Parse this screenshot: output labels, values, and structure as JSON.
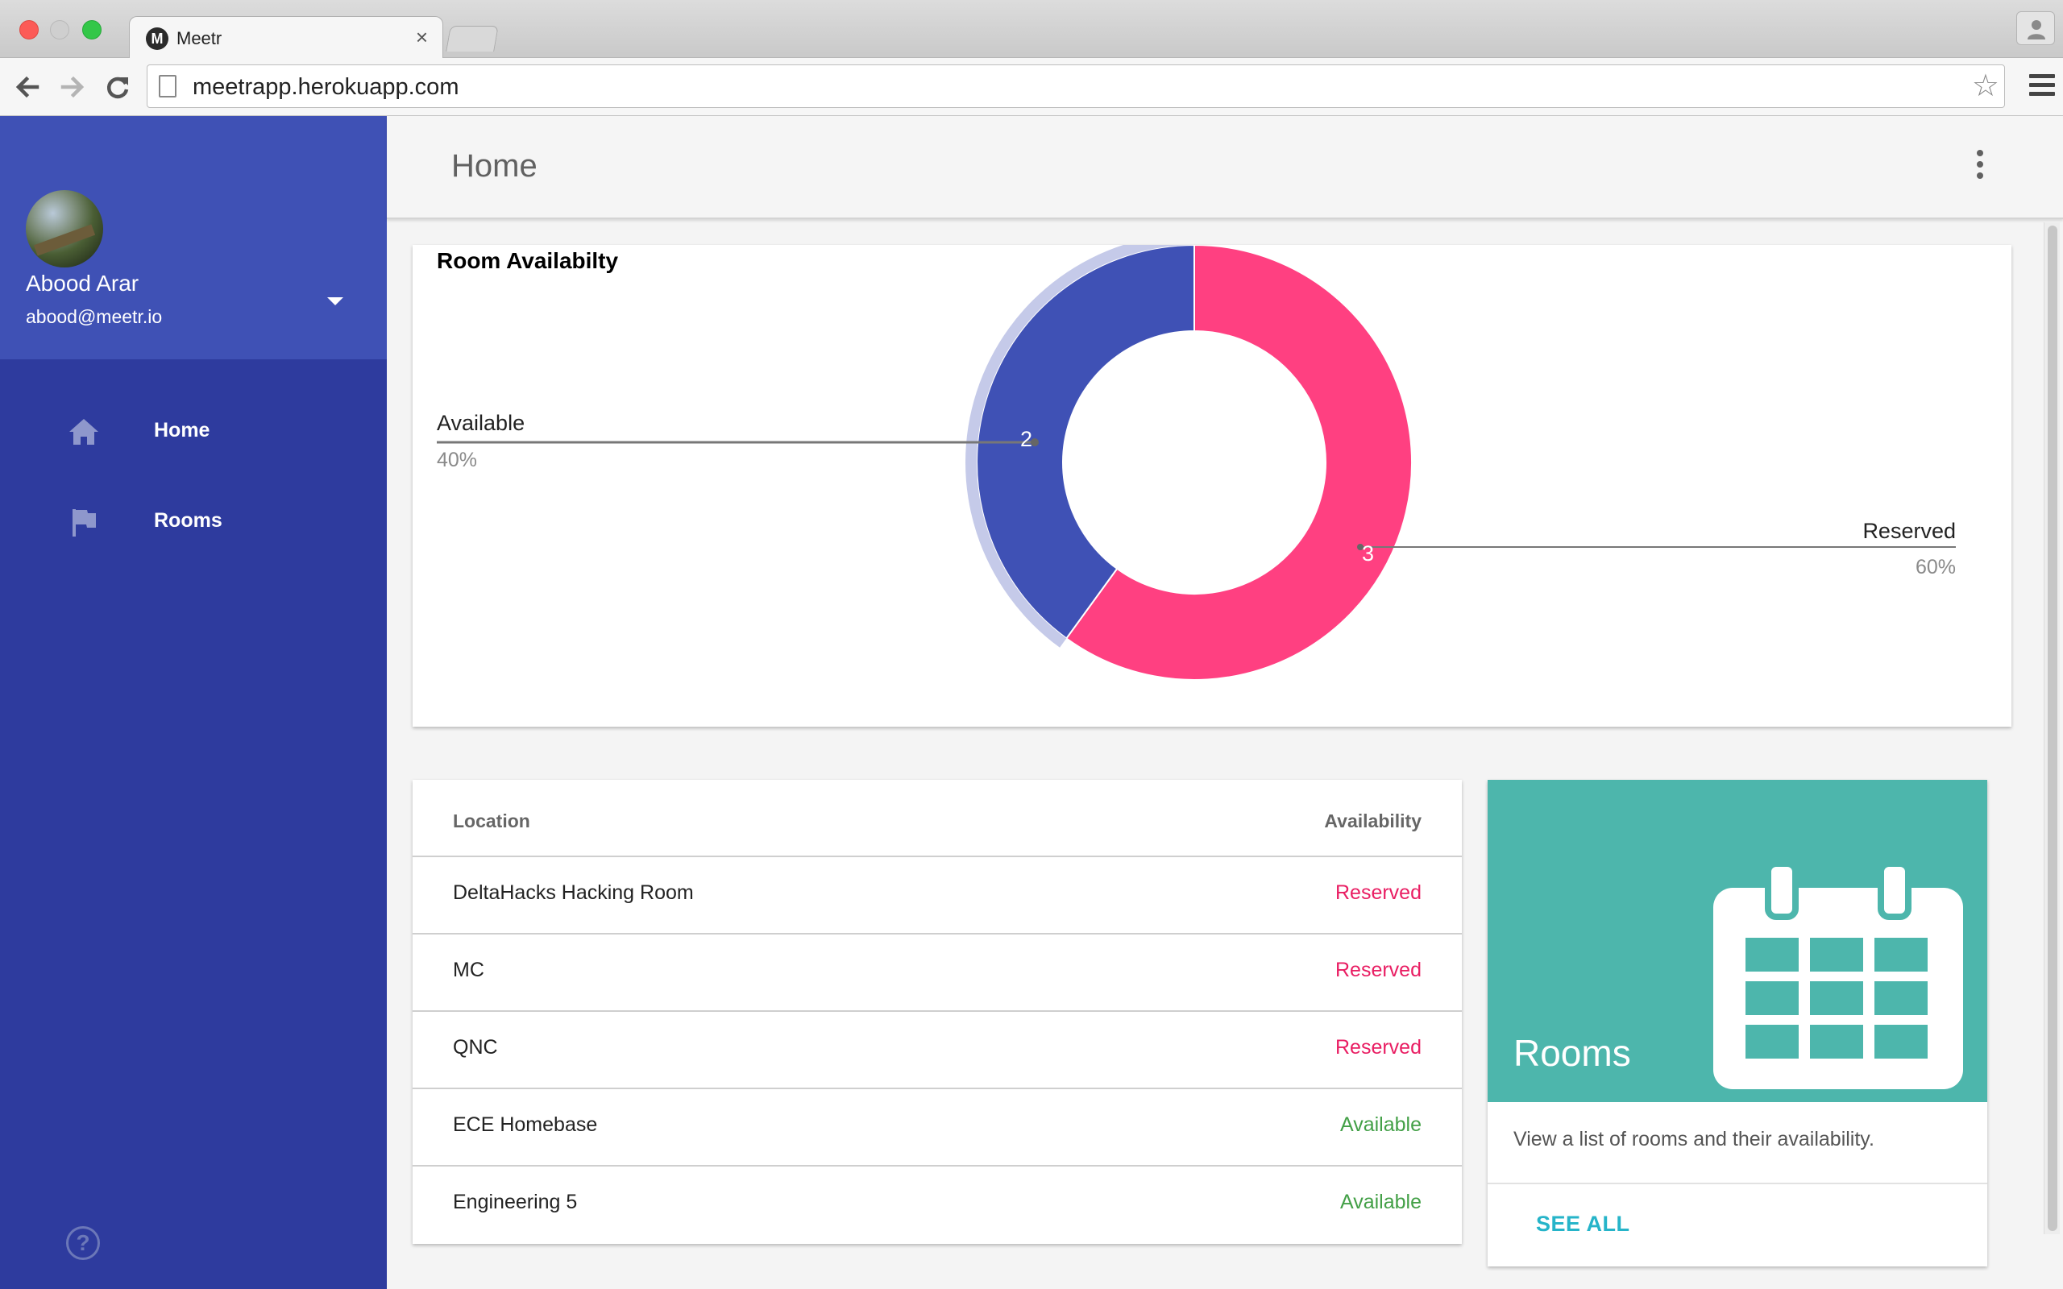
{
  "browser": {
    "tab_title": "Meetr",
    "tab_favicon_letter": "M",
    "tab_close": "×",
    "url": "meetrapp.herokuapp.com",
    "star_glyph": "☆"
  },
  "sidebar": {
    "user_name": "Abood Arar",
    "user_email": "abood@meetr.io",
    "items": [
      {
        "label": "Home",
        "icon": "home-icon"
      },
      {
        "label": "Rooms",
        "icon": "flag-icon"
      }
    ],
    "help_glyph": "?"
  },
  "header": {
    "title": "Home"
  },
  "chart_card": {
    "title": "Room Availabilty"
  },
  "chart_data": {
    "type": "pie",
    "title": "Room Availabilty",
    "donut": true,
    "slices": [
      {
        "label": "Available",
        "value": 2,
        "percent": "40%",
        "color": "#3f51b5"
      },
      {
        "label": "Reserved",
        "value": 3,
        "percent": "60%",
        "color": "#ff4081"
      }
    ]
  },
  "table": {
    "headers": {
      "location": "Location",
      "availability": "Availability"
    },
    "rows": [
      {
        "location": "DeltaHacks Hacking Room",
        "availability": "Reserved"
      },
      {
        "location": "MC",
        "availability": "Reserved"
      },
      {
        "location": "QNC",
        "availability": "Reserved"
      },
      {
        "location": "ECE Homebase",
        "availability": "Available"
      },
      {
        "location": "Engineering 5",
        "availability": "Available"
      }
    ],
    "colors": {
      "Reserved": "#e91e63",
      "Available": "#43a047"
    }
  },
  "rooms_card": {
    "title": "Rooms",
    "icon": "calendar-icon",
    "description": "View a list of rooms and their availability.",
    "link_label": "SEE ALL"
  }
}
